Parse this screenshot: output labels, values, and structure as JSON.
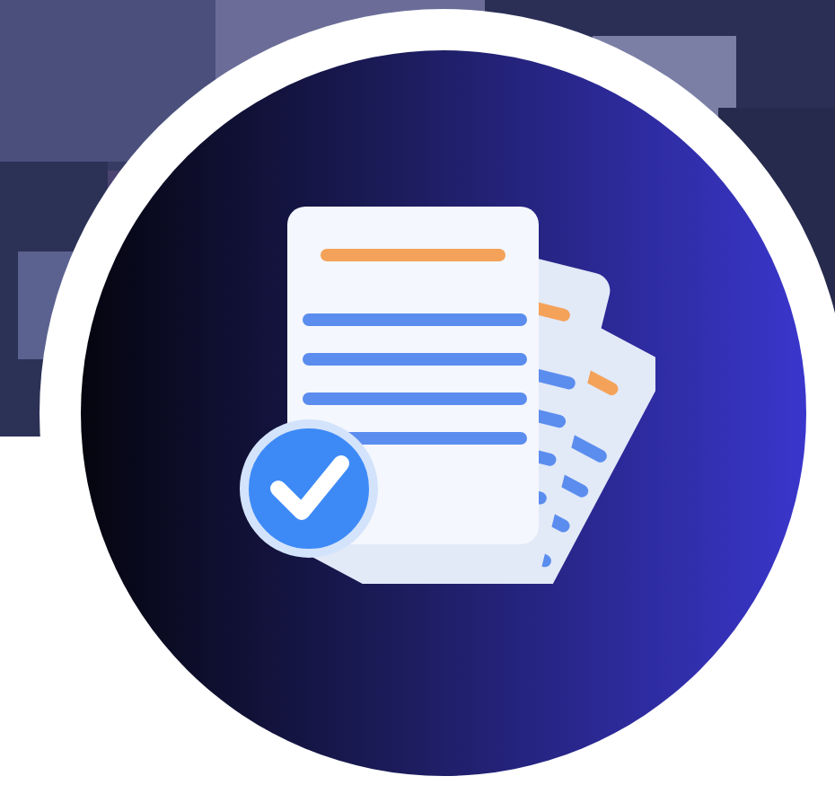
{
  "avatar": {
    "kind": "logo"
  }
}
